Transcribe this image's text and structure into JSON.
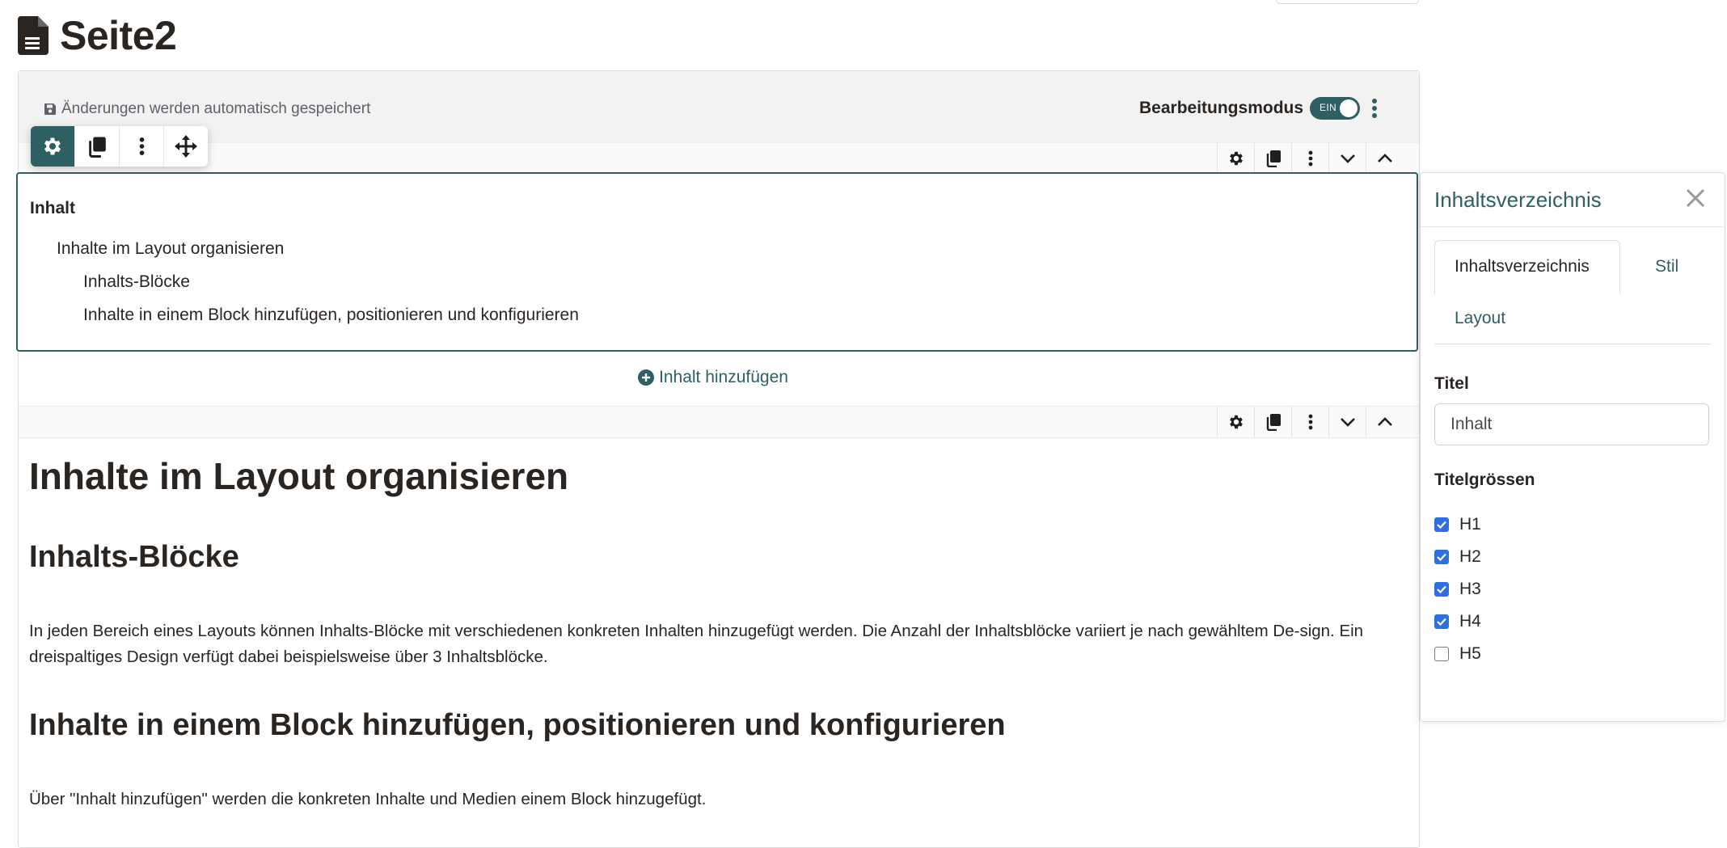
{
  "page": {
    "title": "Seite2"
  },
  "editor": {
    "autosave_text": "Änderungen werden automatisch gespeichert",
    "edit_mode_label": "Bearbeitungsmodus",
    "toggle_text": "EIN"
  },
  "toc_block": {
    "title": "Inhalt",
    "items": [
      {
        "label": "Inhalte im Layout organisieren",
        "level": 1
      },
      {
        "label": "Inhalts-Blöcke",
        "level": 2
      },
      {
        "label": "Inhalte in einem Block hinzufügen, positionieren und konfigurieren",
        "level": 2
      }
    ]
  },
  "add_content_label": "Inhalt hinzufügen",
  "content": {
    "h1": "Inhalte im Layout organisieren",
    "h2_1": "Inhalts-Blöcke",
    "para_1": "In jeden Bereich eines Layouts können Inhalts-Blöcke mit verschiedenen konkreten Inhalten hinzugefügt werden. Die Anzahl der Inhaltsblöcke variiert je nach gewähltem De-sign. Ein dreispaltiges Design verfügt dabei beispielsweise über 3 Inhaltsblöcke.",
    "h2_2": "Inhalte in einem Block hinzufügen, positionieren und konfigurieren",
    "para_2": "Über \"Inhalt hinzufügen\" werden die konkreten Inhalte und Medien einem Block hinzugefügt."
  },
  "panel": {
    "title": "Inhaltsverzeichnis",
    "tabs": [
      "Inhaltsverzeichnis",
      "Stil",
      "Layout"
    ],
    "title_field_label": "Titel",
    "title_field_value": "Inhalt",
    "sizes_label": "Titelgrössen",
    "checkboxes": [
      {
        "label": "H1",
        "checked": true
      },
      {
        "label": "H2",
        "checked": true
      },
      {
        "label": "H3",
        "checked": true
      },
      {
        "label": "H4",
        "checked": true
      },
      {
        "label": "H5",
        "checked": false
      }
    ]
  },
  "colors": {
    "accent": "#2d5f63",
    "checkbox": "#2f6fe4",
    "text": "#2b2522"
  }
}
